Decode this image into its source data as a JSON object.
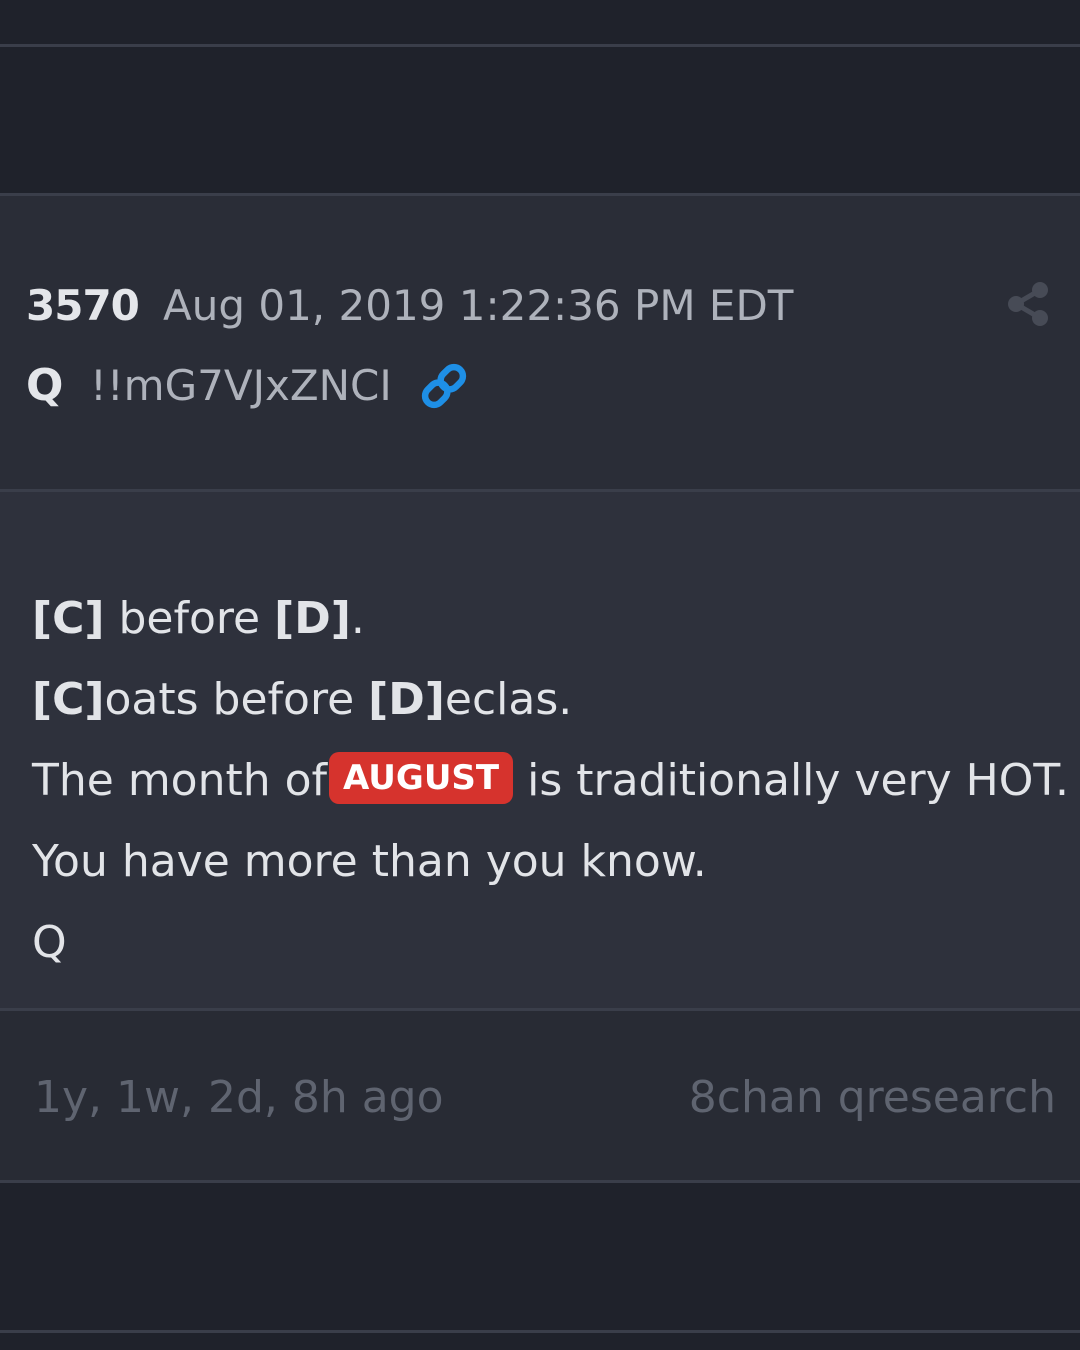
{
  "post": {
    "number": "3570",
    "date": "Aug 01, 2019 1:22:36 PM EDT",
    "author": "Q",
    "tripcode": "!!mG7VJxZNCI",
    "icons": {
      "share": "share-icon",
      "link": "link-icon"
    }
  },
  "body": {
    "line1": {
      "part1": "[C]",
      "part2": " before ",
      "part3": "[D]",
      "part4": "."
    },
    "line2": {
      "part1": "[C]",
      "part2": "oats before ",
      "part3": "[D]",
      "part4": "eclas."
    },
    "line3": {
      "before": "The month of",
      "badge": "AUGUST",
      "after": "is traditionally very HOT."
    },
    "line4": "You have more than you know.",
    "line5": "Q"
  },
  "footer": {
    "age": "1y, 1w, 2d, 8h ago",
    "source": "8chan qresearch"
  },
  "colors": {
    "background": "#1f222b",
    "badge": "#d6332d",
    "link_icon": "#1e8fe6"
  }
}
